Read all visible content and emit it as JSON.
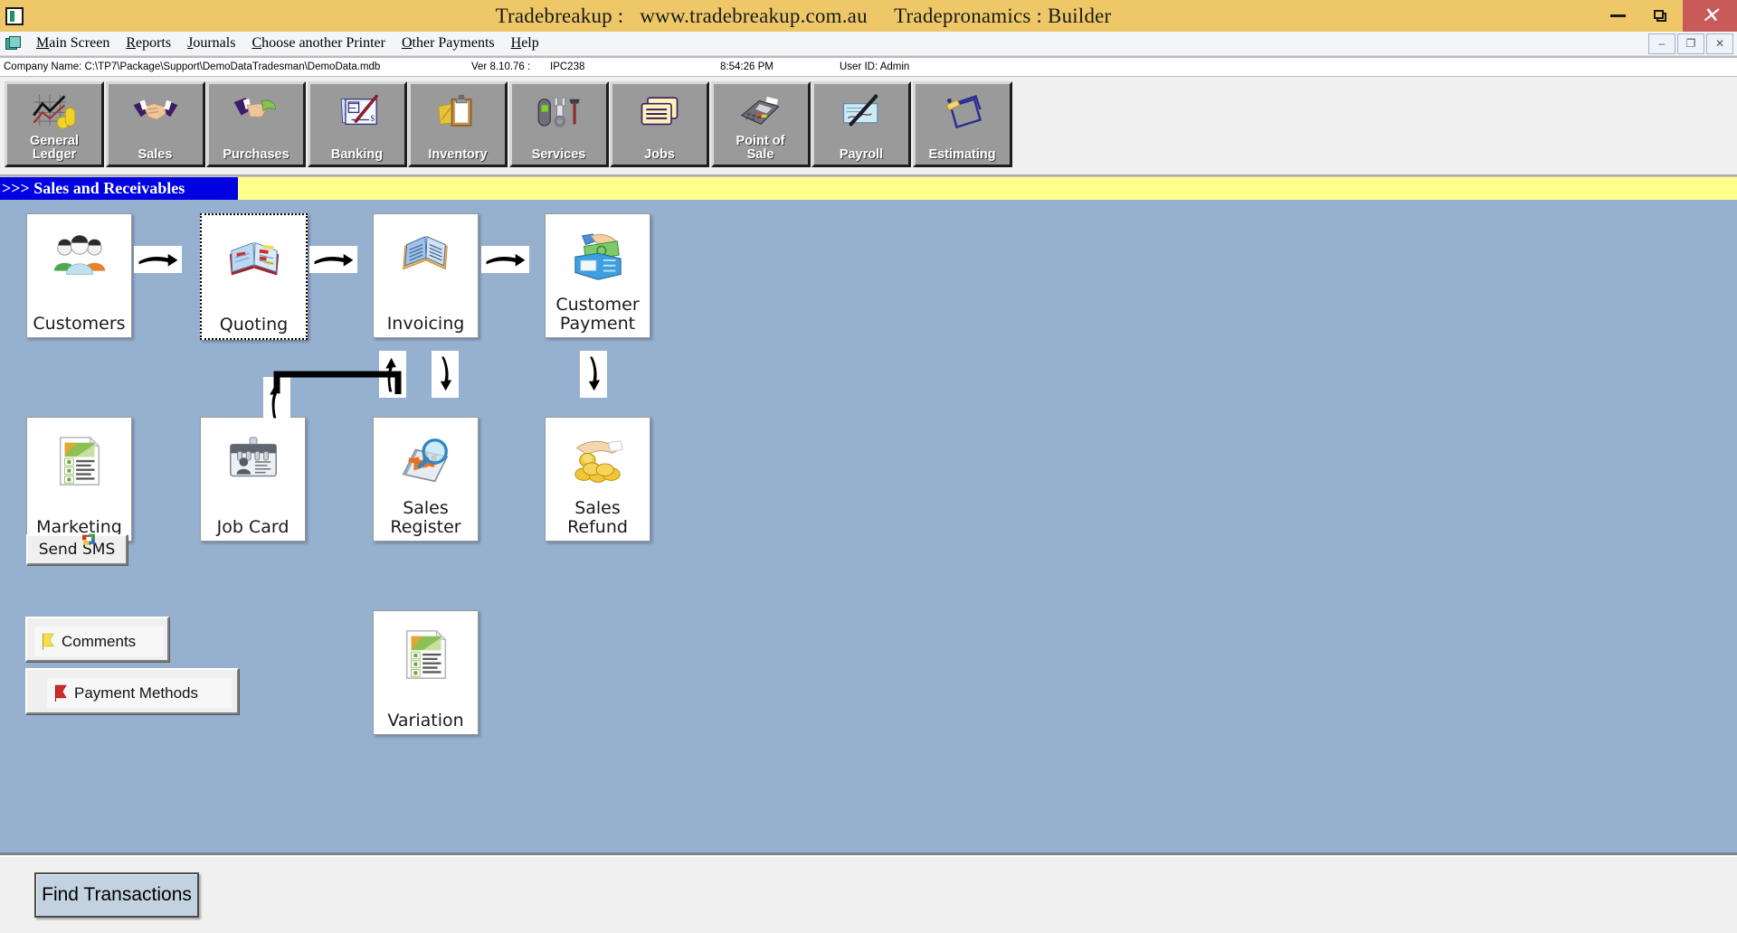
{
  "window": {
    "app_icon": "app-window-icon",
    "title": "Tradebreakup :   www.tradebreakup.com.au     Tradepronamics : Builder",
    "minimize_label": "–",
    "restore_label": "❐",
    "close_label": "✕",
    "titlebar_color": "#eec868",
    "close_button_color": "#c85a5a"
  },
  "menubar": {
    "icon": "mdi-windows-icon",
    "items": [
      {
        "label": "Main Screen"
      },
      {
        "label": "Reports"
      },
      {
        "label": "Journals"
      },
      {
        "label": "Choose another Printer"
      },
      {
        "label": "Other Payments"
      },
      {
        "label": "Help"
      }
    ],
    "mdi_buttons": [
      {
        "name": "mdi-minimize",
        "glyph": "–"
      },
      {
        "name": "mdi-restore",
        "glyph": "❐"
      },
      {
        "name": "mdi-close",
        "glyph": "✕"
      }
    ]
  },
  "infobar": {
    "company": "Company Name: C:\\TP7\\Package\\Support\\DemoDataTradesman\\DemoData.mdb",
    "version": "Ver 8.10.76 :",
    "machine": "IPC238",
    "time": "8:54:26 PM",
    "user": "User ID: Admin"
  },
  "modules": [
    {
      "label": "General\nLedger",
      "icon": "chart-coins-icon"
    },
    {
      "label": "Sales",
      "icon": "handshake-icon"
    },
    {
      "label": "Purchases",
      "icon": "hand-money-icon"
    },
    {
      "label": "Banking",
      "icon": "cheque-pen-icon"
    },
    {
      "label": "Inventory",
      "icon": "clipboard-icon"
    },
    {
      "label": "Services",
      "icon": "tools-icon"
    },
    {
      "label": "Jobs",
      "icon": "cards-icon"
    },
    {
      "label": "Point of\nSale",
      "icon": "eftpos-terminal-icon"
    },
    {
      "label": "Payroll",
      "icon": "cheque-signature-icon"
    },
    {
      "label": "Estimating",
      "icon": "clipboard-pencil-icon"
    }
  ],
  "banner": {
    "text": ">>>  Sales and Receivables",
    "blue": "#0000e0",
    "yellow": "#ffff8c"
  },
  "content": {
    "background": "#96b0d0",
    "tiles": [
      {
        "id": "customers",
        "label": "Customers",
        "icon": "people-group-icon",
        "focused": false
      },
      {
        "id": "quoting",
        "label": "Quoting",
        "icon": "open-book-quote-icon",
        "focused": true
      },
      {
        "id": "invoicing",
        "label": "Invoicing",
        "icon": "open-book-blue-icon",
        "focused": false
      },
      {
        "id": "customer-payment",
        "label": "Customer\nPayment",
        "icon": "hand-cash-wallet-icon",
        "focused": false
      },
      {
        "id": "marketing",
        "label": "Marketing",
        "icon": "document-chart-icon",
        "focused": false
      },
      {
        "id": "job-card",
        "label": "Job Card",
        "icon": "id-badge-icon",
        "focused": false
      },
      {
        "id": "sales-register",
        "label": "Sales\nRegister",
        "icon": "chart-magnifier-icon",
        "focused": false
      },
      {
        "id": "sales-refund",
        "label": "Sales\nRefund",
        "icon": "hand-coins-icon",
        "focused": false
      },
      {
        "id": "variation",
        "label": "Variation",
        "icon": "document-chart-icon",
        "focused": false
      }
    ],
    "buttons": [
      {
        "id": "send-sms",
        "label": "Send SMS",
        "icon": "sms-colored-icon"
      },
      {
        "id": "comments",
        "label": "Comments",
        "icon": "yellow-flag-icon"
      },
      {
        "id": "payment-methods",
        "label": "Payment Methods",
        "icon": "red-flag-icon"
      }
    ],
    "arrows": [
      {
        "id": "customers-to-quoting",
        "direction": "right"
      },
      {
        "id": "quoting-to-invoicing",
        "direction": "right"
      },
      {
        "id": "invoicing-to-payment",
        "direction": "right"
      },
      {
        "id": "invoicing-up",
        "direction": "up"
      },
      {
        "id": "invoicing-down",
        "direction": "down"
      },
      {
        "id": "payment-down",
        "direction": "down"
      },
      {
        "id": "jobcard-up",
        "direction": "up"
      }
    ]
  },
  "footer": {
    "find_transactions_label": "Find Transactions"
  }
}
